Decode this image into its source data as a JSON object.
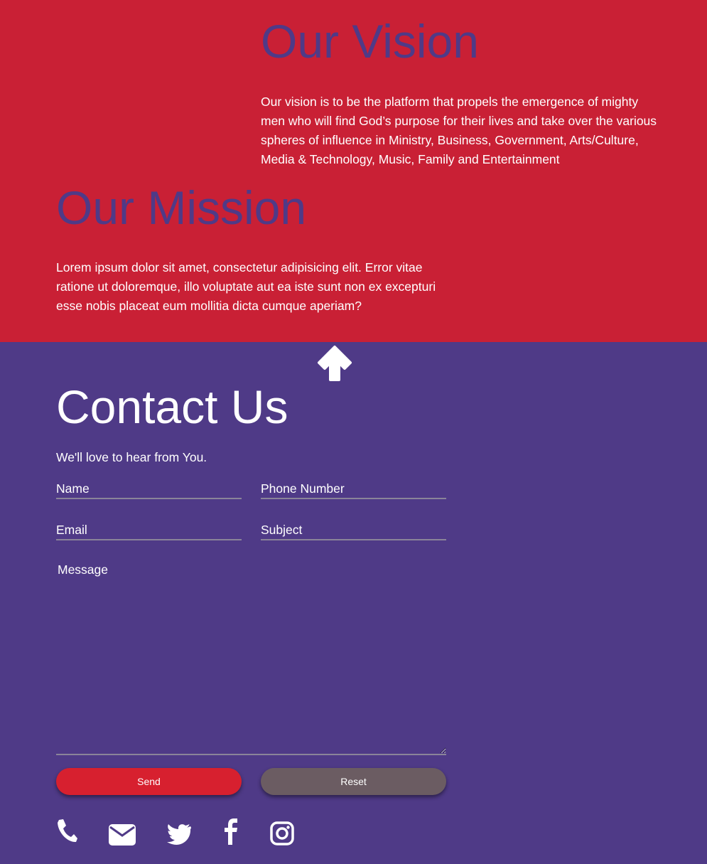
{
  "vision": {
    "title": "Our Vision",
    "text": "Our vision is to be the platform that propels the emergence of mighty men who will find God’s purpose for their lives and take over the various spheres of influence in Ministry, Business, Government, Arts/Culture, Media & Technology, Music, Family and Entertainment"
  },
  "mission": {
    "title": "Our Mission",
    "text": "Lorem ipsum dolor sit amet, consectetur adipisicing elit. Error vitae ratione ut doloremque, illo voluptate aut ea iste sunt non ex excepturi esse nobis placeat eum mollitia dicta cumque aperiam?"
  },
  "back_to_top": {
    "icon": "arrow-up-icon"
  },
  "contact": {
    "title": "Contact Us",
    "subtitle": "We'll love to hear from You.",
    "form": {
      "name_placeholder": "Name",
      "phone_placeholder": "Phone Number",
      "email_placeholder": "Email",
      "subject_placeholder": "Subject",
      "message_placeholder": "Message",
      "send_label": "Send",
      "reset_label": "Reset"
    }
  },
  "social": [
    "phone-icon",
    "envelope-icon",
    "twitter-icon",
    "facebook-icon",
    "instagram-icon"
  ],
  "colors": {
    "red_background": "#c92035",
    "purple_background": "#4f3a87",
    "heading_purple": "#4f3a87",
    "send_button": "#d7202f",
    "reset_button": "#6b5c62",
    "text": "#ffffff"
  }
}
